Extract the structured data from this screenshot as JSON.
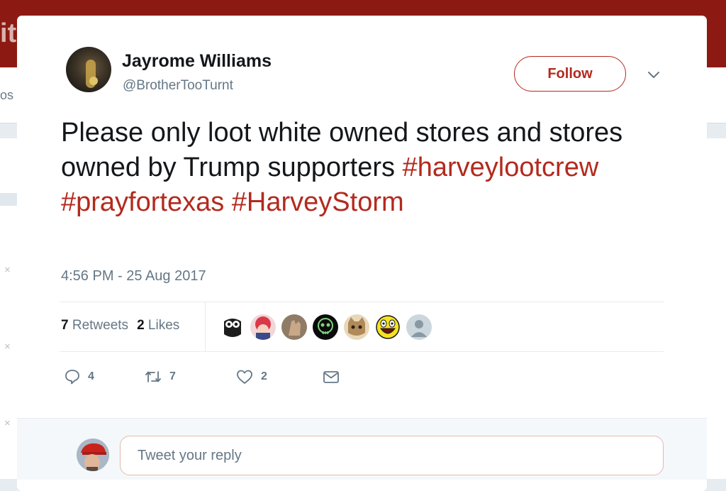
{
  "background": {
    "logo_fragment": "it",
    "nav_fragment": "os",
    "dismiss_glyph": "×"
  },
  "tweet": {
    "author": {
      "name": "Jayrome Williams",
      "handle": "@BrotherTooTurnt"
    },
    "follow_label": "Follow",
    "text_segments": [
      "Please only loot white owned stores and stores owned by Trump supporters ",
      "#harveylootcrew",
      " ",
      "#prayfortexas",
      " ",
      "#HarveyStorm"
    ],
    "timestamp": "4:56 PM - 25 Aug 2017",
    "stats": {
      "retweets_count": "7",
      "retweets_label": "Retweets",
      "likes_count": "2",
      "likes_label": "Likes"
    },
    "likers": [
      "owl-avatar",
      "anime-avatar",
      "hand-avatar",
      "skull-avatar",
      "cat-avatar",
      "smiley-avatar",
      "default-avatar"
    ],
    "actions": {
      "reply_count": "4",
      "retweet_count": "7",
      "like_count": "2"
    }
  },
  "reply_box": {
    "placeholder": "Tweet your reply"
  },
  "colors": {
    "accent": "#b32a1e",
    "header": "#8c1a12",
    "secondary_text": "#657786"
  }
}
